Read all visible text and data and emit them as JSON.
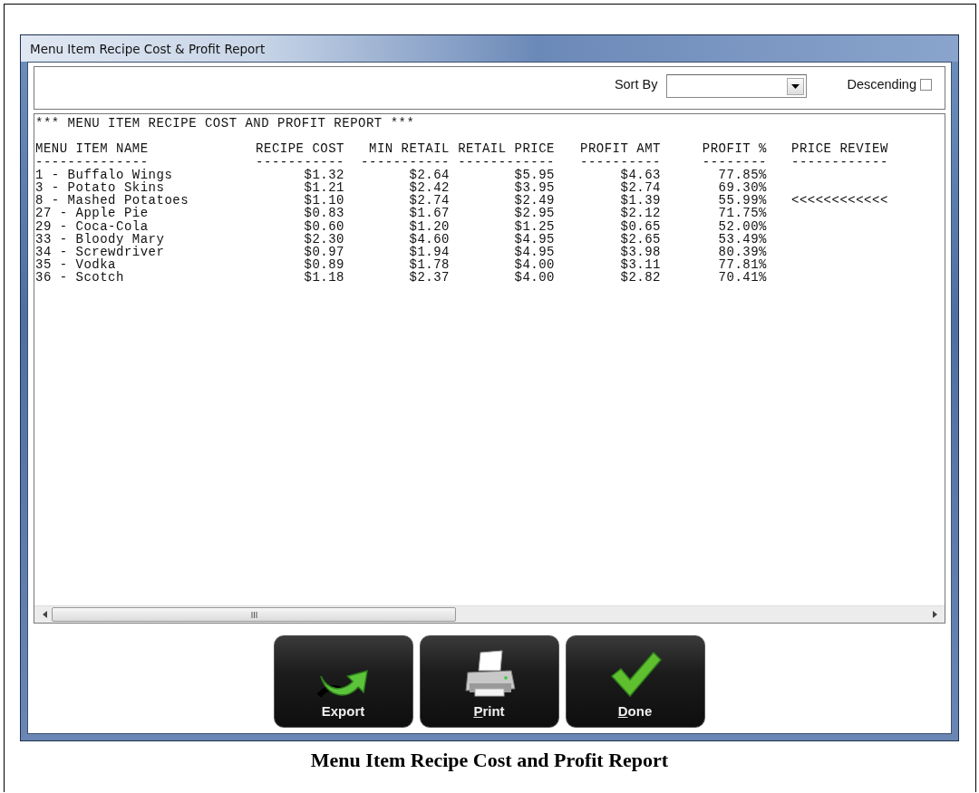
{
  "window": {
    "title": "Menu Item Recipe Cost & Profit Report"
  },
  "toolbar": {
    "sort_by": {
      "label": "Sort By"
    },
    "descending": {
      "label": "Descending",
      "checked": false
    }
  },
  "report": {
    "title": "*** MENU ITEM RECIPE COST AND PROFIT REPORT ***",
    "columns": [
      {
        "heading": "MENU ITEM NAME",
        "rule": "--------------"
      },
      {
        "heading": "RECIPE COST",
        "rule": "-----------"
      },
      {
        "heading": "MIN RETAIL",
        "rule": "-----------"
      },
      {
        "heading": "RETAIL PRICE",
        "rule": "------------"
      },
      {
        "heading": "PROFIT AMT",
        "rule": "----------"
      },
      {
        "heading": "PROFIT %",
        "rule": "--------"
      },
      {
        "heading": "PRICE REVIEW",
        "rule": "------------"
      }
    ],
    "rows": [
      {
        "cells": [
          "1 - Buffalo Wings",
          "$1.32",
          "$2.64",
          "$5.95",
          "$4.63",
          "77.85%"
        ]
      },
      {
        "cells": [
          "3 - Potato Skins",
          "$1.21",
          "$2.42",
          "$3.95",
          "$2.74",
          "69.30%"
        ]
      },
      {
        "cells": [
          "8 - Mashed Potatoes",
          "$1.10",
          "$2.74",
          "$2.49",
          "$1.39",
          "55.99%",
          "<<<<<<<<<<<<"
        ]
      },
      {
        "cells": [
          "27 - Apple Pie",
          "$0.83",
          "$1.67",
          "$2.95",
          "$2.12",
          "71.75%"
        ]
      },
      {
        "cells": [
          "29 - Coca-Cola",
          "$0.60",
          "$1.20",
          "$1.25",
          "$0.65",
          "52.00%"
        ]
      },
      {
        "cells": [
          "33 - Bloody Mary",
          "$2.30",
          "$4.60",
          "$4.95",
          "$2.65",
          "53.49%"
        ]
      },
      {
        "cells": [
          "34 - Screwdriver",
          "$0.97",
          "$1.94",
          "$4.95",
          "$3.98",
          "80.39%"
        ]
      },
      {
        "cells": [
          "35 - Vodka",
          "$0.89",
          "$1.78",
          "$4.00",
          "$3.11",
          "77.81%"
        ]
      },
      {
        "cells": [
          "36 - Scotch",
          "$1.18",
          "$2.37",
          "$4.00",
          "$2.82",
          "70.41%"
        ]
      }
    ]
  },
  "buttons": [
    {
      "label": "Export",
      "kind": "export",
      "access_key_underlined": false
    },
    {
      "label": "Print",
      "kind": "print",
      "access_key_underlined": true
    },
    {
      "label": "Done",
      "kind": "done",
      "access_key_underlined": true
    }
  ],
  "caption": "Menu Item Recipe Cost and Profit Report"
}
